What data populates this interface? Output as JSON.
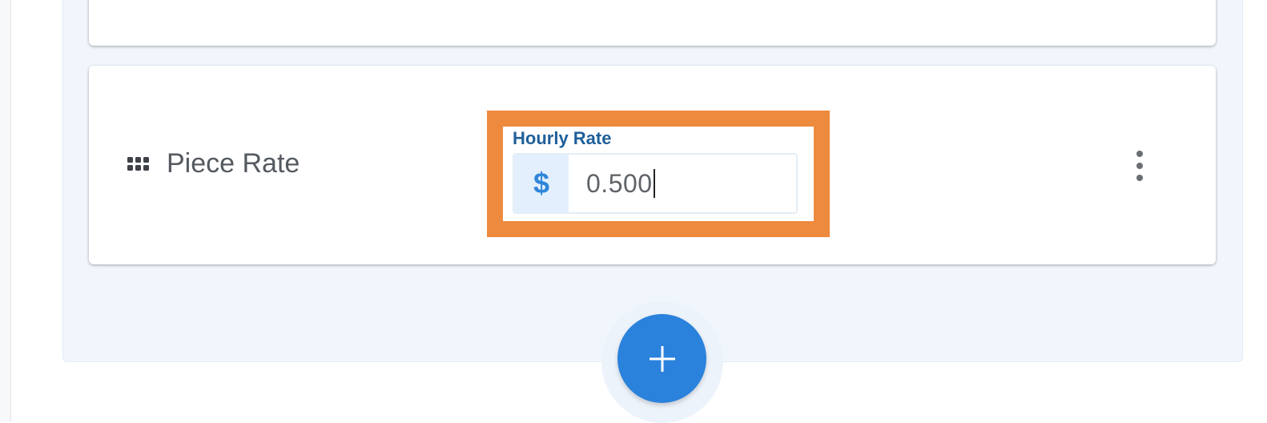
{
  "row": {
    "title": "Piece Rate"
  },
  "rate_field": {
    "label": "Hourly Rate",
    "prefix": "$",
    "value": "0.500"
  },
  "icons": {
    "drag": "drag-handle-icon",
    "more": "more-vert-icon",
    "add": "plus-icon"
  },
  "colors": {
    "accent": "#2a82dc",
    "label": "#1f5f99",
    "highlight": "#ee8a3e",
    "panel": "#f1f6fd"
  }
}
